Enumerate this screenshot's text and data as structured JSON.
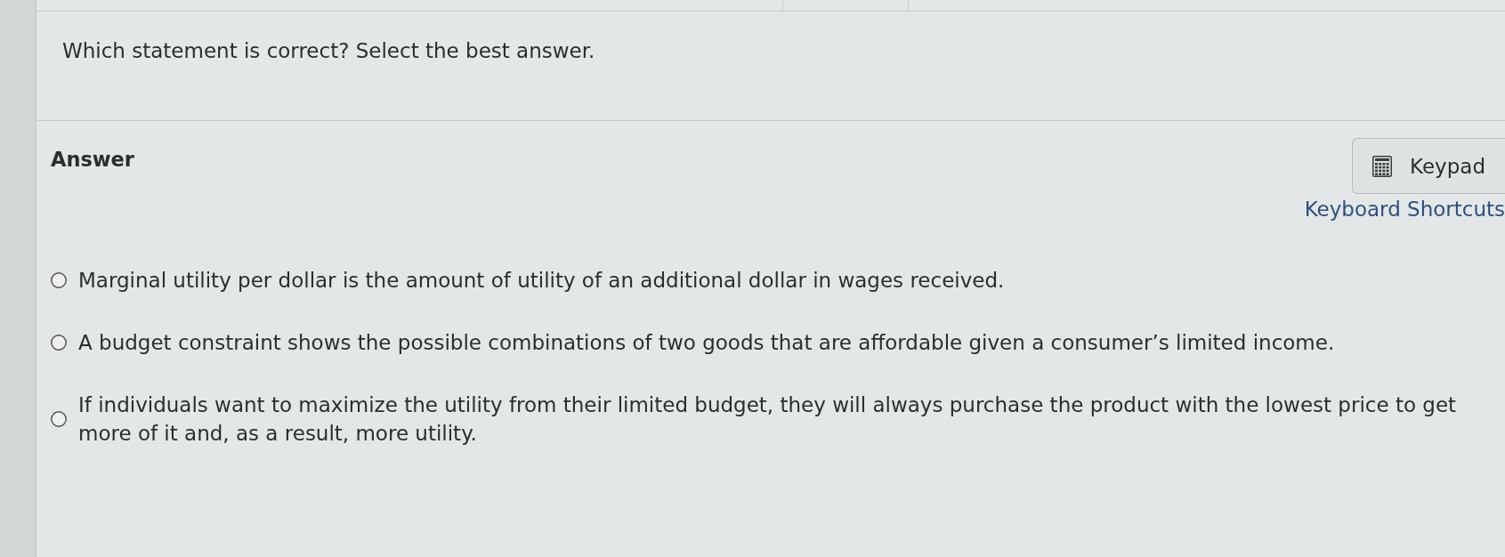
{
  "question": {
    "text": "Which statement is correct? Select the best answer."
  },
  "answer": {
    "heading": "Answer",
    "keypad_button": {
      "label": "Keypad"
    },
    "shortcuts_link": "Keyboard Shortcuts",
    "options": [
      {
        "text": "Marginal utility per dollar is the amount of utility of an additional dollar in wages received.",
        "selected": false
      },
      {
        "text": "A budget constraint shows the possible combinations of two goods that are affordable given a consumer’s limited income.",
        "selected": false
      },
      {
        "text": "If individuals want to maximize the utility from their limited budget, they will always purchase the product with the lowest price to get more of it and, as a result, more utility.",
        "selected": false
      }
    ]
  }
}
